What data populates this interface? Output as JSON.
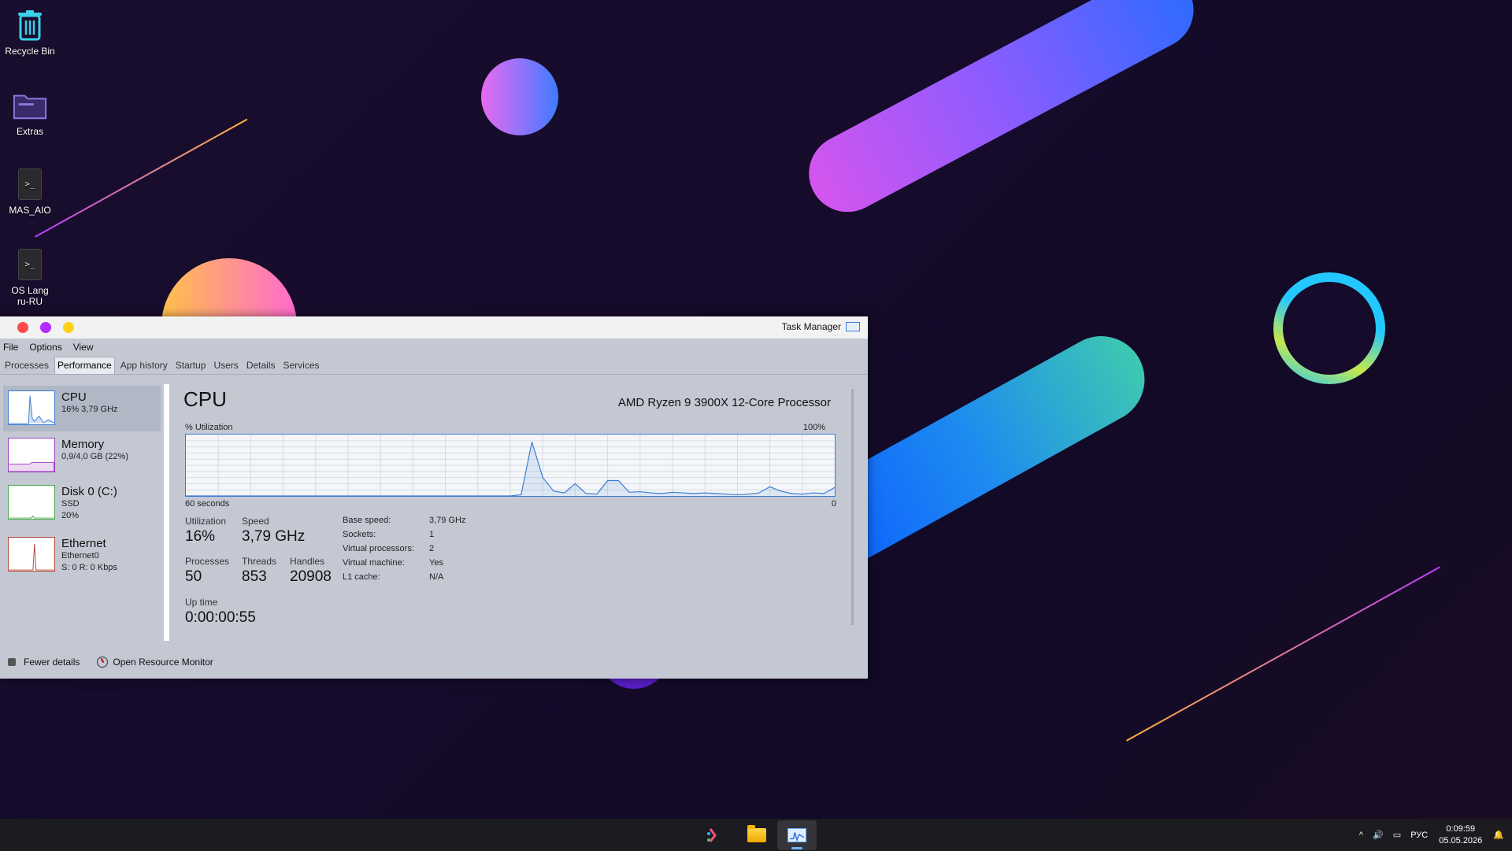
{
  "desktop": {
    "icons": [
      {
        "label": "Recycle Bin",
        "icon": "recycle-bin-icon"
      },
      {
        "label": "Extras",
        "icon": "folder-icon"
      },
      {
        "label": "MAS_AIO",
        "icon": "script-icon"
      },
      {
        "label": "OS Lang\nru-RU",
        "icon": "script-icon"
      }
    ]
  },
  "window": {
    "title": "Task Manager",
    "controls": {
      "close": "#ff4b4b",
      "minimize": "#b22bff",
      "maximize": "#ffd21a"
    },
    "menu": [
      "File",
      "Options",
      "View"
    ],
    "tabs": [
      "Processes",
      "Performance",
      "App history",
      "Startup",
      "Users",
      "Details",
      "Services"
    ],
    "active_tab": "Performance",
    "sidebar": [
      {
        "name": "CPU",
        "sub1": "16% 3,79 GHz",
        "sub2": "",
        "sub3": "",
        "color": "#3b7bd6"
      },
      {
        "name": "Memory",
        "sub1": "0,9/4,0 GB (22%)",
        "sub2": "",
        "sub3": "",
        "color": "#9b3bbf"
      },
      {
        "name": "Disk 0 (C:)",
        "sub1": "SSD",
        "sub2": "20%",
        "sub3": "",
        "color": "#4aa84a"
      },
      {
        "name": "Ethernet",
        "sub1": "Ethernet0",
        "sub2": "S: 0 R: 0 Kbps",
        "sub3": "",
        "color": "#b04a3a"
      }
    ],
    "main": {
      "title": "CPU",
      "model": "AMD Ryzen 9 3900X 12-Core Processor",
      "util_label": "% Utilization",
      "util_max": "100%",
      "time_label": "60 seconds",
      "zero": "0",
      "stats": {
        "utilization": {
          "label": "Utilization",
          "value": "16%"
        },
        "speed": {
          "label": "Speed",
          "value": "3,79 GHz"
        },
        "processes": {
          "label": "Processes",
          "value": "50"
        },
        "threads": {
          "label": "Threads",
          "value": "853"
        },
        "handles": {
          "label": "Handles",
          "value": "20908"
        },
        "uptime": {
          "label": "Up time",
          "value": "0:00:00:55"
        }
      },
      "props": [
        {
          "k": "Base speed:",
          "v": "3,79 GHz"
        },
        {
          "k": "Sockets:",
          "v": "1"
        },
        {
          "k": "Virtual processors:",
          "v": "2"
        },
        {
          "k": "Virtual machine:",
          "v": "Yes"
        },
        {
          "k": "L1 cache:",
          "v": "N/A"
        }
      ]
    },
    "footer": {
      "fewer": "Fewer details",
      "monitor": "Open Resource Monitor"
    }
  },
  "chart_data": {
    "type": "line",
    "title": "",
    "xlabel": "60 seconds",
    "ylabel": "% Utilization",
    "ylim": [
      0,
      100
    ],
    "x": [
      0,
      1,
      2,
      3,
      4,
      5,
      6,
      7,
      8,
      9,
      10,
      11,
      12,
      13,
      14,
      15,
      16,
      17,
      18,
      19,
      20,
      21,
      22,
      23,
      24,
      25,
      26,
      27,
      28,
      29,
      30,
      31,
      32,
      33,
      34,
      35,
      36,
      37,
      38,
      39,
      40,
      41,
      42,
      43,
      44,
      45,
      46,
      47,
      48,
      49,
      50,
      51,
      52,
      53,
      54,
      55,
      56,
      57,
      58,
      59,
      60
    ],
    "series": [
      {
        "values": [
          0,
          0,
          0,
          0,
          0,
          0,
          0,
          0,
          0,
          0,
          0,
          0,
          0,
          0,
          0,
          0,
          0,
          0,
          0,
          0,
          0,
          0,
          0,
          0,
          0,
          0,
          0,
          0,
          0,
          0,
          0,
          2,
          88,
          30,
          8,
          5,
          20,
          4,
          3,
          25,
          25,
          6,
          7,
          5,
          4,
          6,
          5,
          4,
          5,
          4,
          3,
          2,
          3,
          5,
          15,
          8,
          4,
          3,
          5,
          4,
          14
        ]
      }
    ]
  },
  "taskbar": {
    "apps": [
      "start-icon",
      "file-explorer-icon",
      "task-manager-icon"
    ],
    "lang": "РУС",
    "time": "0:09:59",
    "date": "05.05.2026"
  }
}
